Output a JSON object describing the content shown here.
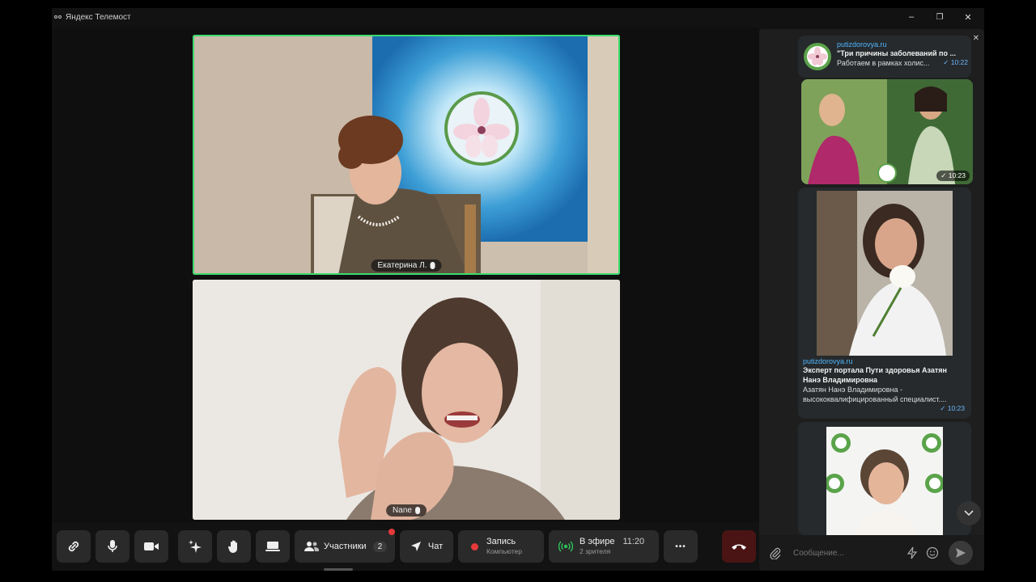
{
  "window": {
    "title": "Яндекс Телемост",
    "minimize": "–",
    "maximize": "❐",
    "close": "✕"
  },
  "participants": [
    {
      "name": "Екатерина Л.",
      "speaking": true
    },
    {
      "name": "Nane",
      "speaking": false
    }
  ],
  "toolbar": {
    "participants_label": "Участники",
    "participants_count": "2",
    "chat_label": "Чат",
    "record_label": "Запись",
    "record_sub": "Компьютер",
    "live_label": "В эфире",
    "live_time": "11:20",
    "live_sub": "2 зрителя",
    "more": "•••"
  },
  "chat": {
    "close": "✕",
    "messages": [
      {
        "source": "putizdorovya.ru",
        "title": "\"Три причины заболеваний по ...",
        "text": "Работаем в рамках холис...",
        "time": "10:22"
      },
      {
        "time": "10:23"
      },
      {
        "source": "putizdorovya.ru",
        "title_line1": "Эксперт портала Пути здоровья Азатян",
        "title_line2": "Нанэ Владимировна",
        "text_line1": "Азатян Нанэ Владимировна -",
        "text_line2": "высококвалифицированный специалист....",
        "time": "10:23"
      }
    ],
    "composer_placeholder": "Сообщение..."
  },
  "colors": {
    "active_speaker": "#3ddc6e",
    "accent_link": "#4fb6ff",
    "record_dot": "#e5393a",
    "live_icon": "#2fbf5b",
    "hangup_bg": "#4a1414"
  }
}
